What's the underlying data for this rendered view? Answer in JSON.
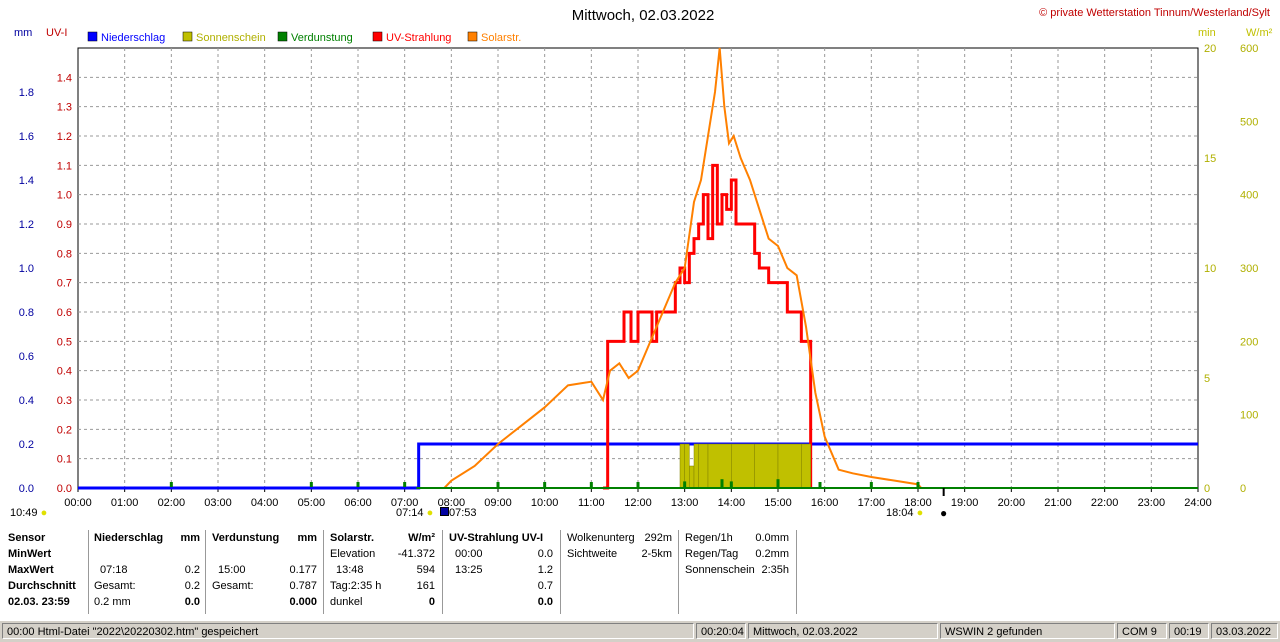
{
  "header": {
    "title": "Mittwoch, 02.03.2022",
    "copyright": "© private Wetterstation Tinnum/Westerland/Sylt",
    "axis_left_units": [
      "mm",
      "UV-I"
    ],
    "axis_right_units": [
      "min",
      "W/m²"
    ]
  },
  "legend": [
    {
      "label": "Niederschlag",
      "color": "#0000ff"
    },
    {
      "label": "Sonnenschein",
      "color": "#c0c000"
    },
    {
      "label": "Verdunstung",
      "color": "#008000"
    },
    {
      "label": "UV-Strahlung",
      "color": "#ff0000"
    },
    {
      "label": "Solarstr.",
      "color": "#ff8000"
    }
  ],
  "markers": {
    "now": "10:49",
    "sunrise": "07:14",
    "civil": "07:53",
    "sunset": "18:04"
  },
  "chart_data": {
    "type": "line",
    "x_range_hours": [
      0,
      24
    ],
    "x_ticks": [
      "00:00",
      "01:00",
      "02:00",
      "03:00",
      "04:00",
      "05:00",
      "06:00",
      "07:00",
      "08:00",
      "09:00",
      "10:00",
      "11:00",
      "12:00",
      "13:00",
      "14:00",
      "15:00",
      "16:00",
      "17:00",
      "18:00",
      "19:00",
      "20:00",
      "21:00",
      "22:00",
      "23:00",
      "24:00"
    ],
    "axes": {
      "mm": {
        "range": [
          0,
          2.0
        ],
        "ticks": [
          "0.0",
          "0.2",
          "0.4",
          "0.6",
          "0.8",
          "1.0",
          "1.2",
          "1.4",
          "1.6",
          "1.8"
        ],
        "color": "#0000a0"
      },
      "uv": {
        "range": [
          0,
          1.5
        ],
        "ticks": [
          "0.0",
          "0.1",
          "0.2",
          "0.3",
          "0.4",
          "0.5",
          "0.6",
          "0.7",
          "0.8",
          "0.9",
          "1.0",
          "1.1",
          "1.2",
          "1.3",
          "1.4"
        ],
        "color": "#c00000"
      },
      "min": {
        "range": [
          0,
          20
        ],
        "ticks": [
          "0",
          "5",
          "10",
          "15",
          "20"
        ],
        "color": "#c0c000"
      },
      "wm2": {
        "range": [
          0,
          600
        ],
        "ticks": [
          "0",
          "100",
          "200",
          "300",
          "400",
          "500",
          "600"
        ],
        "color": "#c0c000"
      }
    },
    "grid": true,
    "series": [
      {
        "name": "Niederschlag",
        "axis": "mm",
        "color": "#0000ff",
        "x": [
          0,
          7.25,
          7.3,
          24
        ],
        "values": [
          0,
          0,
          0.2,
          0.2
        ]
      },
      {
        "name": "UV-Strahlung",
        "axis": "uv",
        "color": "#ff0000",
        "x": [
          11.25,
          11.35,
          11.6,
          11.7,
          11.85,
          12.0,
          12.3,
          12.4,
          12.6,
          12.8,
          12.9,
          13.0,
          13.1,
          13.2,
          13.3,
          13.4,
          13.5,
          13.6,
          13.7,
          13.8,
          13.9,
          14.0,
          14.1,
          14.2,
          14.3,
          14.5,
          14.6,
          14.8,
          15.0,
          15.2,
          15.4,
          15.5,
          15.6,
          15.7
        ],
        "values": [
          0.0,
          0.5,
          0.5,
          0.6,
          0.5,
          0.6,
          0.5,
          0.6,
          0.6,
          0.7,
          0.75,
          0.7,
          0.8,
          0.85,
          0.9,
          1.0,
          0.85,
          1.1,
          0.9,
          1.0,
          0.95,
          1.05,
          0.9,
          0.9,
          0.9,
          0.8,
          0.75,
          0.7,
          0.7,
          0.6,
          0.6,
          0.5,
          0.5,
          0.0
        ]
      },
      {
        "name": "Solarstr.",
        "axis": "wm2",
        "color": "#ff8000",
        "x": [
          7.85,
          8.0,
          8.5,
          9.0,
          9.5,
          10.0,
          10.5,
          11.0,
          11.25,
          11.4,
          11.6,
          11.8,
          12.0,
          12.2,
          12.4,
          12.6,
          12.8,
          13.0,
          13.2,
          13.35,
          13.5,
          13.65,
          13.75,
          13.85,
          13.95,
          14.05,
          14.2,
          14.4,
          14.6,
          14.8,
          15.0,
          15.2,
          15.4,
          15.6,
          15.8,
          16.0,
          16.3,
          16.6,
          17.0,
          17.5,
          18.0,
          18.07
        ],
        "values": [
          0,
          10,
          30,
          60,
          85,
          110,
          140,
          145,
          120,
          160,
          170,
          150,
          160,
          190,
          220,
          250,
          280,
          300,
          390,
          420,
          480,
          540,
          600,
          520,
          470,
          480,
          450,
          420,
          380,
          340,
          330,
          300,
          290,
          220,
          130,
          70,
          25,
          20,
          15,
          10,
          5,
          0
        ]
      },
      {
        "name": "Sonnenschein",
        "axis": "min",
        "color": "#c0c000",
        "x": [
          12.9,
          13.0,
          13.1,
          13.2,
          13.3,
          13.5,
          14.0,
          14.5,
          15.0,
          15.5,
          15.7
        ],
        "values": [
          2,
          2,
          1,
          2,
          2,
          2,
          2,
          2,
          2,
          2,
          0
        ]
      },
      {
        "name": "Verdunstung",
        "axis": "mm",
        "color": "#008000",
        "x": [
          2.0,
          5.0,
          6.0,
          7.0,
          9.0,
          10.0,
          11.0,
          12.0,
          13.0,
          13.8,
          14.0,
          15.0,
          15.9,
          17.0,
          18.0
        ],
        "values": [
          0.01,
          0.01,
          0.01,
          0.01,
          0.01,
          0.01,
          0.01,
          0.02,
          0.03,
          0.04,
          0.03,
          0.04,
          0.02,
          0.01,
          0.01
        ]
      }
    ]
  },
  "table": {
    "sensor": {
      "header": "Sensor",
      "rows": [
        "MinWert",
        "MaxWert",
        "Durchschnitt",
        "02.03.  23:59"
      ]
    },
    "niederschlag": {
      "header": "Niederschlag",
      "unit": "mm",
      "max_time": "07:18",
      "max": "0.2",
      "gesamt_label": "Gesamt:",
      "gesamt": "0.2",
      "avg": "0.2 mm",
      "total": "0.0"
    },
    "verdunstung": {
      "header": "Verdunstung",
      "unit": "mm",
      "max_time": "15:00",
      "max": "0.177",
      "gesamt_label": "Gesamt:",
      "gesamt": "0.787",
      "total": "0.000"
    },
    "solar": {
      "header": "Solarstr.",
      "unit": "W/m²",
      "elev_label": "Elevation",
      "elev": "-41.372",
      "max_time": "13:48",
      "max": "594",
      "tag_label": "Tag:2:35 h",
      "tag": "161",
      "dunkel_label": "dunkel",
      "total": "0"
    },
    "uv": {
      "header": "UV-Strahlung UV-I",
      "min_time": "00:00",
      "min": "0.0",
      "max_time": "13:25",
      "max": "1.2",
      "avg": "0.7",
      "total": "0.0"
    },
    "cloud": {
      "wolken_label": "Wolkenunterg",
      "wolken": "292m",
      "sicht_label": "Sichtweite",
      "sicht": "2-5km"
    },
    "rain": {
      "r1_label": "Regen/1h",
      "r1": "0.0mm",
      "rt_label": "Regen/Tag",
      "rt": "0.2mm",
      "sun_label": "Sonnenschein",
      "sun": "2:35h"
    }
  },
  "statusbar": {
    "file": "00:00  Html-Datei  \"2022\\20220302.htm\"  gespeichert",
    "time": "00:20:04",
    "date": "Mittwoch, 02.03.2022",
    "wswin": "WSWIN 2 gefunden",
    "com": "COM 9",
    "clock": "00:19",
    "today": "03.03.2022"
  }
}
